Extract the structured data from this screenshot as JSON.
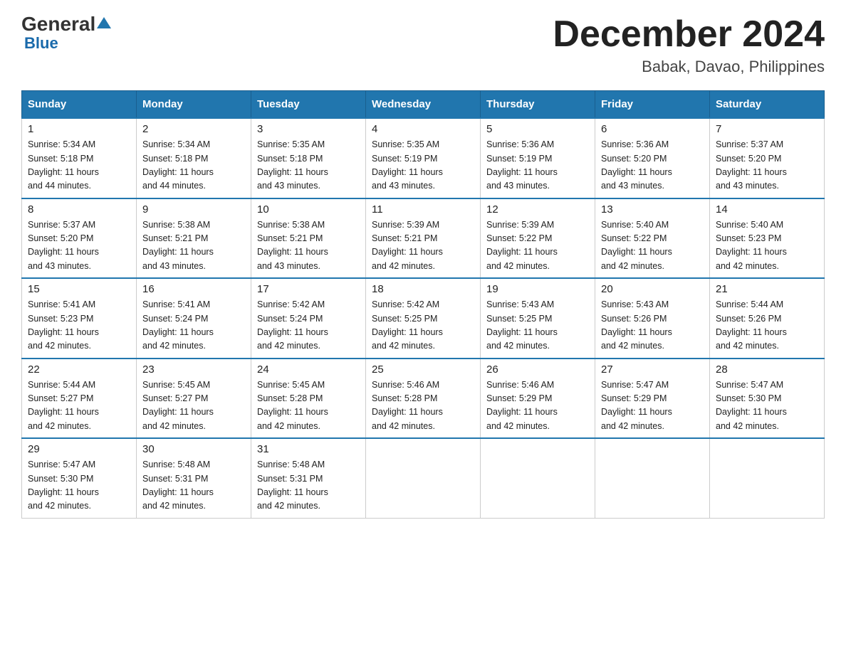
{
  "header": {
    "logo_general": "General",
    "logo_blue": "Blue",
    "month_title": "December 2024",
    "location": "Babak, Davao, Philippines"
  },
  "days_of_week": [
    "Sunday",
    "Monday",
    "Tuesday",
    "Wednesday",
    "Thursday",
    "Friday",
    "Saturday"
  ],
  "weeks": [
    [
      {
        "day": "1",
        "sunrise": "5:34 AM",
        "sunset": "5:18 PM",
        "daylight": "11 hours and 44 minutes."
      },
      {
        "day": "2",
        "sunrise": "5:34 AM",
        "sunset": "5:18 PM",
        "daylight": "11 hours and 44 minutes."
      },
      {
        "day": "3",
        "sunrise": "5:35 AM",
        "sunset": "5:18 PM",
        "daylight": "11 hours and 43 minutes."
      },
      {
        "day": "4",
        "sunrise": "5:35 AM",
        "sunset": "5:19 PM",
        "daylight": "11 hours and 43 minutes."
      },
      {
        "day": "5",
        "sunrise": "5:36 AM",
        "sunset": "5:19 PM",
        "daylight": "11 hours and 43 minutes."
      },
      {
        "day": "6",
        "sunrise": "5:36 AM",
        "sunset": "5:20 PM",
        "daylight": "11 hours and 43 minutes."
      },
      {
        "day": "7",
        "sunrise": "5:37 AM",
        "sunset": "5:20 PM",
        "daylight": "11 hours and 43 minutes."
      }
    ],
    [
      {
        "day": "8",
        "sunrise": "5:37 AM",
        "sunset": "5:20 PM",
        "daylight": "11 hours and 43 minutes."
      },
      {
        "day": "9",
        "sunrise": "5:38 AM",
        "sunset": "5:21 PM",
        "daylight": "11 hours and 43 minutes."
      },
      {
        "day": "10",
        "sunrise": "5:38 AM",
        "sunset": "5:21 PM",
        "daylight": "11 hours and 43 minutes."
      },
      {
        "day": "11",
        "sunrise": "5:39 AM",
        "sunset": "5:21 PM",
        "daylight": "11 hours and 42 minutes."
      },
      {
        "day": "12",
        "sunrise": "5:39 AM",
        "sunset": "5:22 PM",
        "daylight": "11 hours and 42 minutes."
      },
      {
        "day": "13",
        "sunrise": "5:40 AM",
        "sunset": "5:22 PM",
        "daylight": "11 hours and 42 minutes."
      },
      {
        "day": "14",
        "sunrise": "5:40 AM",
        "sunset": "5:23 PM",
        "daylight": "11 hours and 42 minutes."
      }
    ],
    [
      {
        "day": "15",
        "sunrise": "5:41 AM",
        "sunset": "5:23 PM",
        "daylight": "11 hours and 42 minutes."
      },
      {
        "day": "16",
        "sunrise": "5:41 AM",
        "sunset": "5:24 PM",
        "daylight": "11 hours and 42 minutes."
      },
      {
        "day": "17",
        "sunrise": "5:42 AM",
        "sunset": "5:24 PM",
        "daylight": "11 hours and 42 minutes."
      },
      {
        "day": "18",
        "sunrise": "5:42 AM",
        "sunset": "5:25 PM",
        "daylight": "11 hours and 42 minutes."
      },
      {
        "day": "19",
        "sunrise": "5:43 AM",
        "sunset": "5:25 PM",
        "daylight": "11 hours and 42 minutes."
      },
      {
        "day": "20",
        "sunrise": "5:43 AM",
        "sunset": "5:26 PM",
        "daylight": "11 hours and 42 minutes."
      },
      {
        "day": "21",
        "sunrise": "5:44 AM",
        "sunset": "5:26 PM",
        "daylight": "11 hours and 42 minutes."
      }
    ],
    [
      {
        "day": "22",
        "sunrise": "5:44 AM",
        "sunset": "5:27 PM",
        "daylight": "11 hours and 42 minutes."
      },
      {
        "day": "23",
        "sunrise": "5:45 AM",
        "sunset": "5:27 PM",
        "daylight": "11 hours and 42 minutes."
      },
      {
        "day": "24",
        "sunrise": "5:45 AM",
        "sunset": "5:28 PM",
        "daylight": "11 hours and 42 minutes."
      },
      {
        "day": "25",
        "sunrise": "5:46 AM",
        "sunset": "5:28 PM",
        "daylight": "11 hours and 42 minutes."
      },
      {
        "day": "26",
        "sunrise": "5:46 AM",
        "sunset": "5:29 PM",
        "daylight": "11 hours and 42 minutes."
      },
      {
        "day": "27",
        "sunrise": "5:47 AM",
        "sunset": "5:29 PM",
        "daylight": "11 hours and 42 minutes."
      },
      {
        "day": "28",
        "sunrise": "5:47 AM",
        "sunset": "5:30 PM",
        "daylight": "11 hours and 42 minutes."
      }
    ],
    [
      {
        "day": "29",
        "sunrise": "5:47 AM",
        "sunset": "5:30 PM",
        "daylight": "11 hours and 42 minutes."
      },
      {
        "day": "30",
        "sunrise": "5:48 AM",
        "sunset": "5:31 PM",
        "daylight": "11 hours and 42 minutes."
      },
      {
        "day": "31",
        "sunrise": "5:48 AM",
        "sunset": "5:31 PM",
        "daylight": "11 hours and 42 minutes."
      },
      null,
      null,
      null,
      null
    ]
  ],
  "labels": {
    "sunrise": "Sunrise:",
    "sunset": "Sunset:",
    "daylight": "Daylight:"
  }
}
